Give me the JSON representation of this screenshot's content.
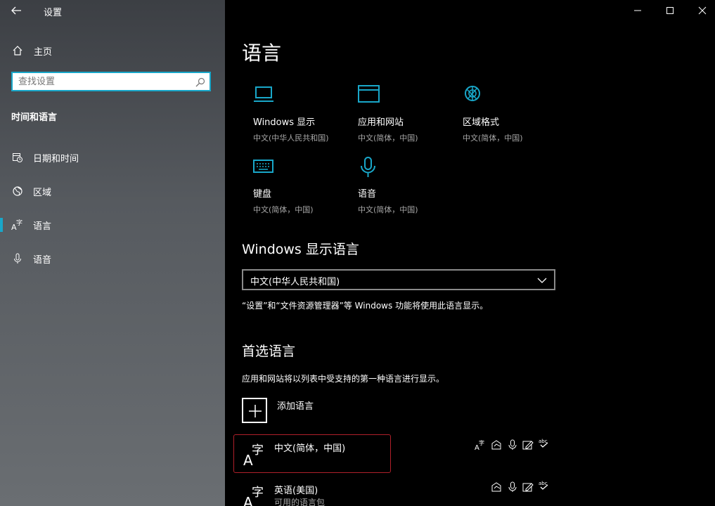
{
  "window": {
    "title": "设置",
    "back_icon": "back-arrow-icon"
  },
  "sidebar": {
    "home_label": "主页",
    "search_placeholder": "查找设置",
    "section_title": "时间和语言",
    "items": [
      {
        "label": "日期和时间",
        "icon": "calendar-clock-icon"
      },
      {
        "label": "区域",
        "icon": "globe-icon"
      },
      {
        "label": "语言",
        "icon": "language-icon",
        "selected": true
      },
      {
        "label": "语音",
        "icon": "microphone-icon"
      }
    ],
    "accent": "#19a7c9"
  },
  "main": {
    "page_title": "语言",
    "categories": [
      {
        "title": "Windows 显示",
        "subtitle": "中文(中华人民共和国)",
        "icon": "laptop-icon"
      },
      {
        "title": "应用和网站",
        "subtitle": "中文(简体，中国)",
        "icon": "browser-window-icon"
      },
      {
        "title": "区域格式",
        "subtitle": "中文(简体，中国)",
        "icon": "globe-format-icon"
      },
      {
        "title": "键盘",
        "subtitle": "中文(简体，中国)",
        "icon": "keyboard-icon"
      },
      {
        "title": "语音",
        "subtitle": "中文(简体，中国)",
        "icon": "microphone-icon"
      }
    ],
    "display_language": {
      "heading": "Windows 显示语言",
      "selected": "中文(中华人民共和国)",
      "description": "“设置”和“文件资源管理器”等 Windows 功能将使用此语言显示。"
    },
    "preferred": {
      "heading": "首选语言",
      "description": "应用和网站将以列表中受支持的第一种语言进行显示。",
      "add_label": "添加语言",
      "languages": [
        {
          "name": "中文(简体，中国)",
          "status": ""
        },
        {
          "name": "英语(美国)",
          "status": "可用的语言包"
        }
      ]
    },
    "highlight_color": "#b0202a"
  }
}
